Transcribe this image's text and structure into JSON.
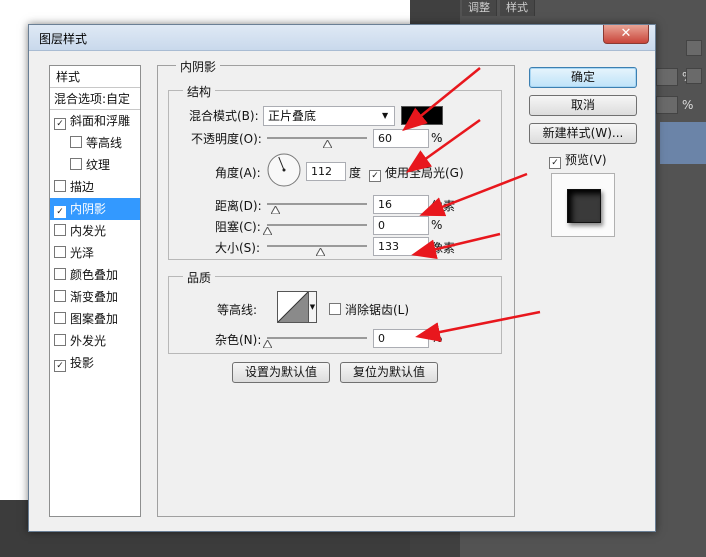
{
  "background": {
    "tabs": [
      "调整",
      "样式"
    ],
    "percent_labels": [
      "%",
      "%"
    ]
  },
  "dialog": {
    "title": "图层样式",
    "close_glyph": "✕"
  },
  "styles_list": {
    "header": "样式",
    "blend_options": "混合选项:自定",
    "items": [
      {
        "label": "斜面和浮雕",
        "checked": true
      },
      {
        "label": "等高线",
        "checked": false
      },
      {
        "label": "纹理",
        "checked": false
      },
      {
        "label": "描边",
        "checked": false
      },
      {
        "label": "内阴影",
        "checked": true,
        "selected": true
      },
      {
        "label": "内发光",
        "checked": false
      },
      {
        "label": "光泽",
        "checked": false
      },
      {
        "label": "颜色叠加",
        "checked": false
      },
      {
        "label": "渐变叠加",
        "checked": false
      },
      {
        "label": "图案叠加",
        "checked": false
      },
      {
        "label": "外发光",
        "checked": false
      },
      {
        "label": "投影",
        "checked": true
      }
    ]
  },
  "inner_shadow": {
    "section_title": "内阴影",
    "structure": {
      "title": "结构",
      "blend_mode_label": "混合模式(B):",
      "blend_mode_value": "正片叠底",
      "shadow_color": "#000000",
      "opacity_label": "不透明度(O):",
      "opacity_value": "60",
      "opacity_unit": "%",
      "opacity_level": 60,
      "angle_label": "角度(A):",
      "angle_value": "112",
      "angle_unit": "度",
      "global_light_label": "使用全局光(G)",
      "global_light_checked": true,
      "distance_label": "距离(D):",
      "distance_value": "16",
      "distance_unit": "像素",
      "distance_level": 0.08,
      "choke_label": "阻塞(C):",
      "choke_value": "0",
      "choke_unit": "%",
      "choke_level": 0,
      "size_label": "大小(S):",
      "size_value": "133",
      "size_unit": "像素",
      "size_level": 0.53
    },
    "quality": {
      "title": "品质",
      "contour_label": "等高线:",
      "antialias_label": "消除锯齿(L)",
      "antialias_checked": false,
      "noise_label": "杂色(N):",
      "noise_value": "0",
      "noise_unit": "%",
      "noise_level": 0
    },
    "make_default": "设置为默认值",
    "reset_default": "复位为默认值"
  },
  "right_buttons": {
    "ok": "确定",
    "cancel": "取消",
    "new_style": "新建样式(W)...",
    "preview_label": "预览(V)",
    "preview_checked": true
  },
  "check_glyph": "✓",
  "accent_color": "#3399ff",
  "annotation_color": "#e8171d"
}
